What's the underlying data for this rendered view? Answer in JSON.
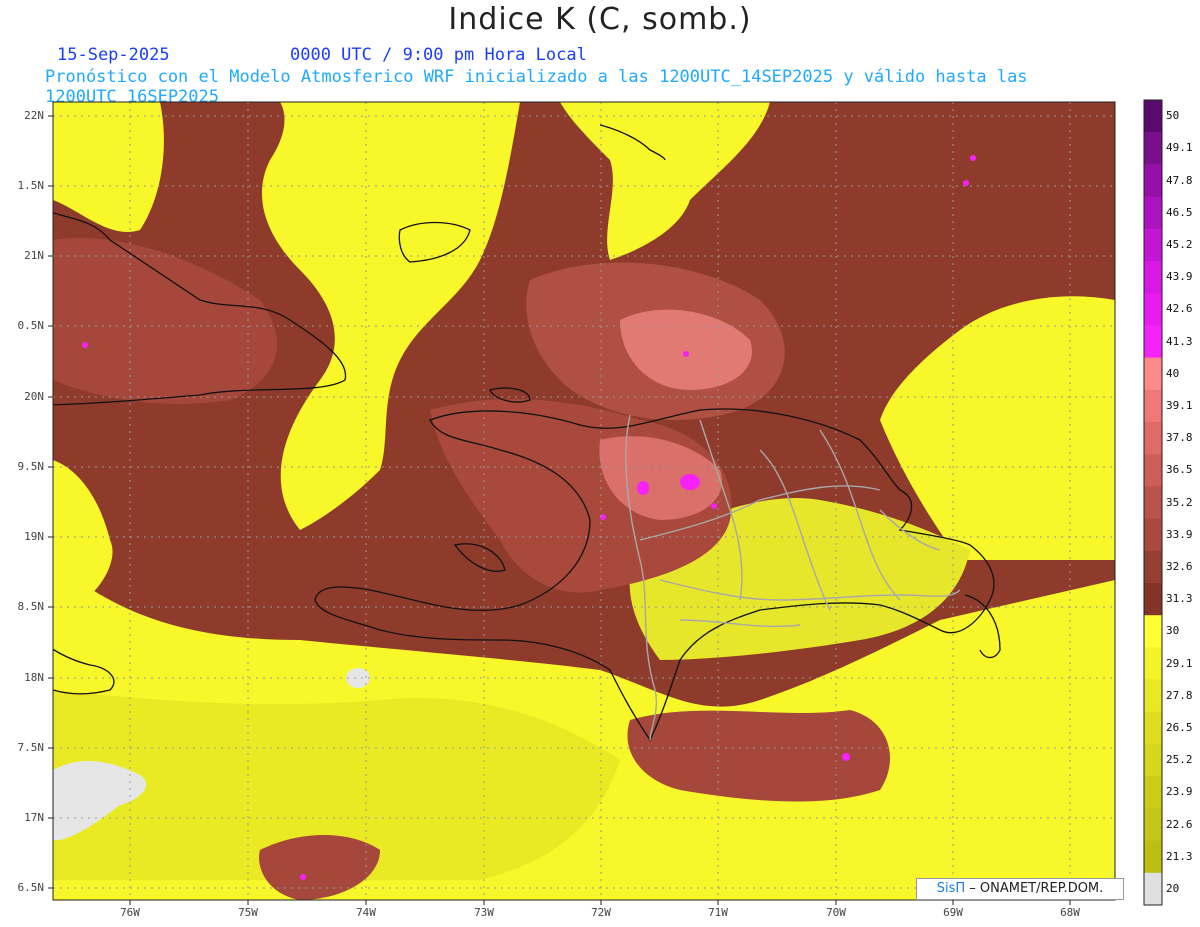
{
  "header": {
    "title": "Indice K (C, somb.)",
    "date": "15-Sep-2025",
    "valid_time": "0000 UTC / 9:00 pm Hora Local",
    "forecast_info": "Pronóstico con el Modelo Atmosferico WRF inicializado a las 1200UTC_14SEP2025 y válido hasta las  1200UTC_16SEP2025"
  },
  "map": {
    "lat_labels": [
      "22N",
      "1.5N",
      "21N",
      "0.5N",
      "20N",
      "9.5N",
      "19N",
      "8.5N",
      "18N",
      "7.5N",
      "17N",
      "6.5N"
    ],
    "lon_labels": [
      "76W",
      "75W",
      "74W",
      "73W",
      "72W",
      "71W",
      "70W",
      "69W",
      "68W"
    ]
  },
  "colorbar": {
    "labels": [
      "50",
      "49.1",
      "47.8",
      "46.5",
      "45.2",
      "43.9",
      "42.6",
      "41.3",
      "40",
      "39.1",
      "37.8",
      "36.5",
      "35.2",
      "33.9",
      "32.6",
      "31.3",
      "30",
      "29.1",
      "27.8",
      "26.5",
      "25.2",
      "23.9",
      "22.6",
      "21.3",
      "20"
    ],
    "colors": [
      "#5a0a6e",
      "#7a0f8c",
      "#9410a8",
      "#ac12c0",
      "#c414d6",
      "#d818e6",
      "#e81cf0",
      "#f522fb",
      "#ff8a8a",
      "#f07878",
      "#e06a66",
      "#cf5e58",
      "#bc534a",
      "#a84a3e",
      "#953f33",
      "#823426",
      "#ffff33",
      "#f3f32a",
      "#e8e824",
      "#dede1f",
      "#d6d61c",
      "#cdcd19",
      "#c5c517",
      "#bdbd14",
      "#e0e0e0"
    ]
  },
  "credit": {
    "brand": "SisΠ",
    "text": "– ONAMET/REP.DOM."
  }
}
